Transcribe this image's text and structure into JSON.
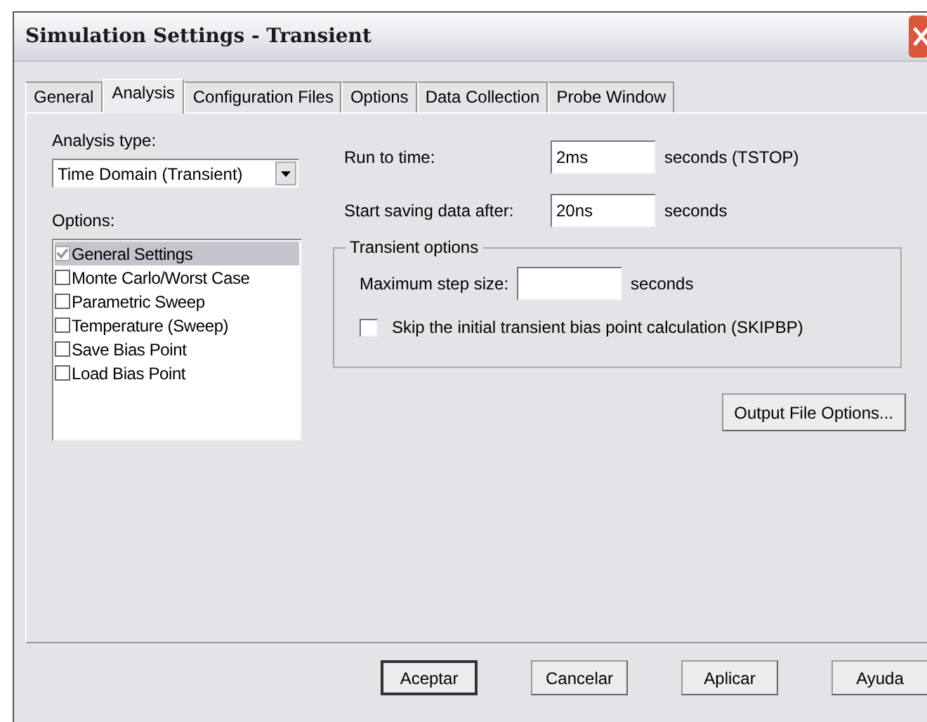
{
  "window": {
    "title": "Simulation Settings - Transient"
  },
  "tabs": [
    {
      "label": "General",
      "selected": false
    },
    {
      "label": "Analysis",
      "selected": true
    },
    {
      "label": "Configuration Files",
      "selected": false
    },
    {
      "label": "Options",
      "selected": false
    },
    {
      "label": "Data Collection",
      "selected": false
    },
    {
      "label": "Probe Window",
      "selected": false
    }
  ],
  "analysis_type": {
    "label": "Analysis type:",
    "value": "Time Domain (Transient)"
  },
  "options": {
    "label": "Options:",
    "items": [
      {
        "label": "General Settings",
        "checked": true,
        "selected": true
      },
      {
        "label": "Monte Carlo/Worst Case",
        "checked": false,
        "selected": false
      },
      {
        "label": "Parametric Sweep",
        "checked": false,
        "selected": false
      },
      {
        "label": "Temperature (Sweep)",
        "checked": false,
        "selected": false
      },
      {
        "label": "Save Bias Point",
        "checked": false,
        "selected": false
      },
      {
        "label": "Load Bias Point",
        "checked": false,
        "selected": false
      }
    ]
  },
  "run_to_time": {
    "label": "Run to time:",
    "value": "2ms",
    "unit": "seconds  (TSTOP)"
  },
  "start_saving": {
    "label": "Start saving data after:",
    "value": "20ns",
    "unit": "seconds"
  },
  "transient_options": {
    "title": "Transient options",
    "max_step": {
      "label": "Maximum step size:",
      "unit": "seconds"
    },
    "skip_bias": {
      "label": "Skip the initial transient bias point calculation  (SKIPBP)",
      "checked": false
    }
  },
  "output_button": "Output File Options...",
  "buttons": [
    {
      "label": "Aceptar",
      "default": true
    },
    {
      "label": "Cancelar",
      "default": false
    },
    {
      "label": "Aplicar",
      "default": false
    },
    {
      "label": "Ayuda",
      "default": false
    }
  ]
}
